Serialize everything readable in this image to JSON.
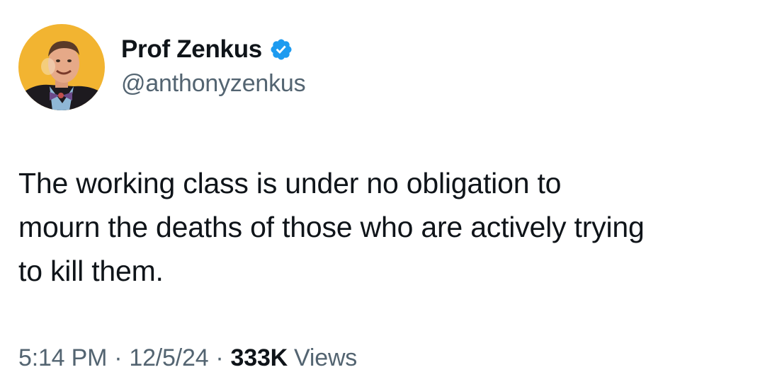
{
  "tweet": {
    "author": {
      "display_name": "Prof Zenkus",
      "handle": "@anthonyzenkus",
      "verified": true,
      "verified_icon": "verified-badge-icon",
      "avatar_icon": "profile-avatar"
    },
    "text": "The working class is under no obligation to\nmourn the deaths of those who are actively trying\nto kill them.",
    "time": "5:14 PM",
    "date": "12/5/24",
    "separator": "·",
    "views_count": "333K",
    "views_label": "Views"
  },
  "colors": {
    "text_primary": "#0f1419",
    "text_secondary": "#536471",
    "verified_blue": "#1d9bf0",
    "avatar_background": "#f0b030"
  }
}
